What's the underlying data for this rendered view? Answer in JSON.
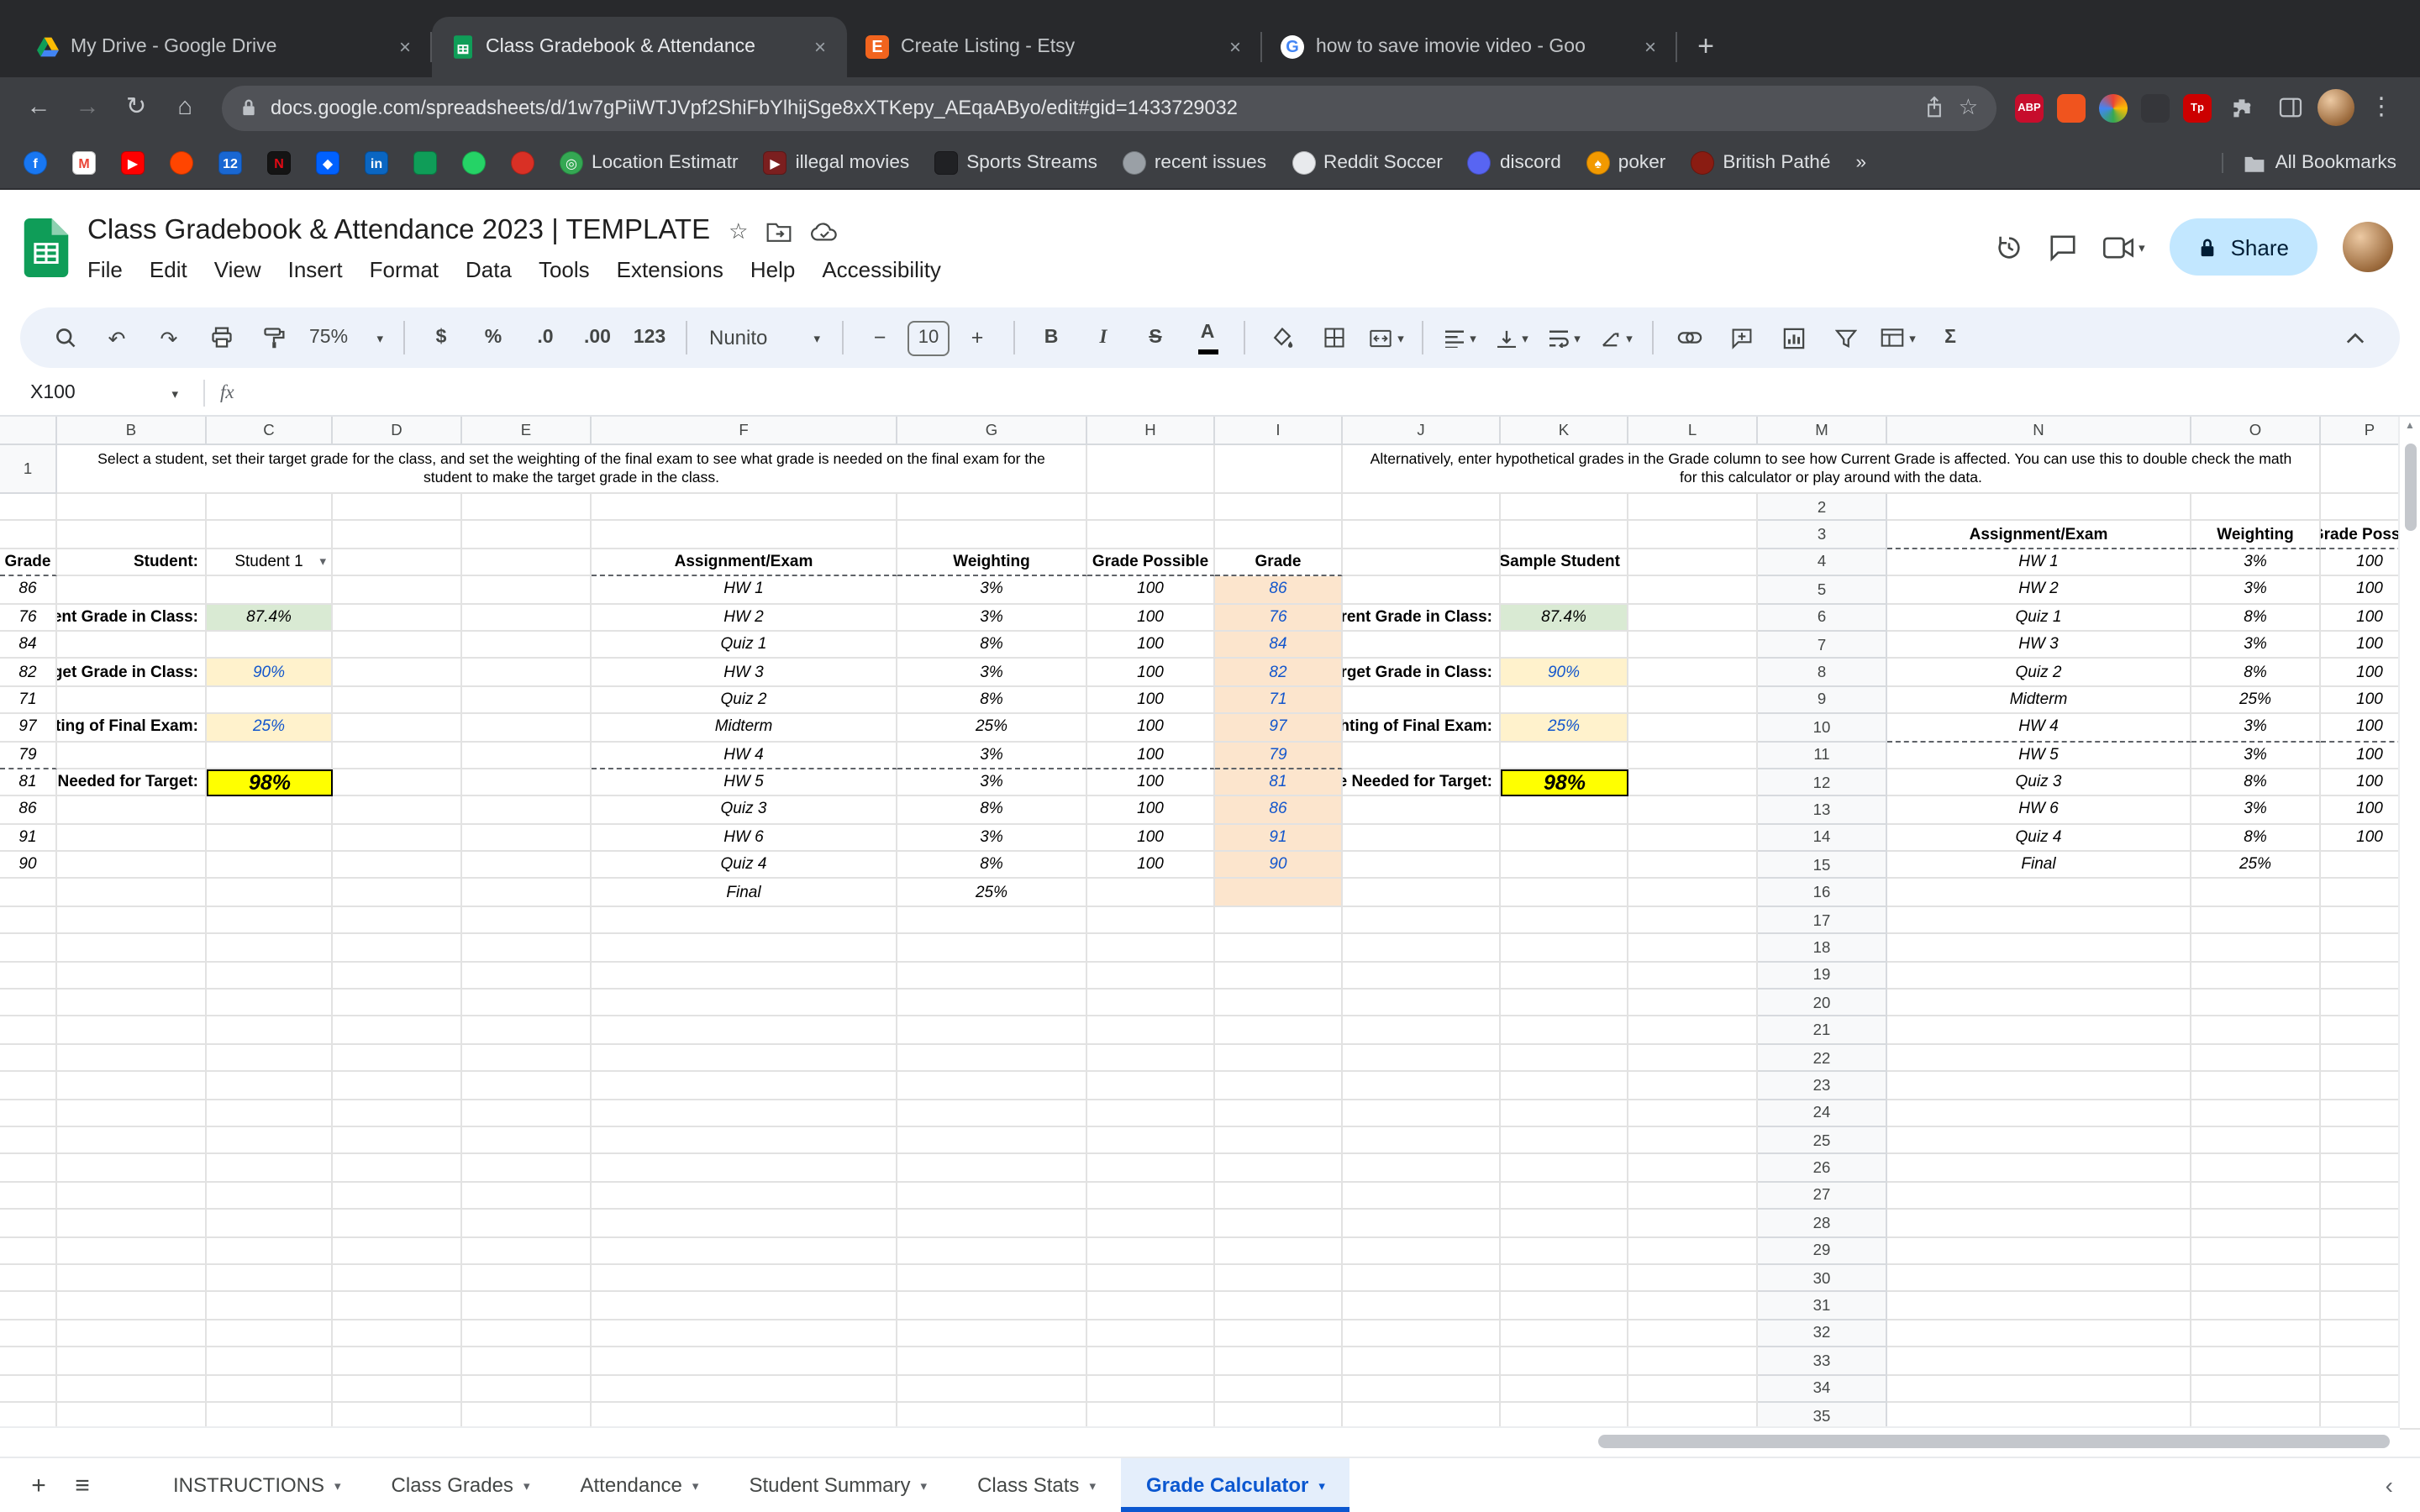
{
  "browser": {
    "tabs": [
      {
        "title": "My Drive - Google Drive",
        "icon": "google-drive"
      },
      {
        "title": "Class Gradebook & Attendance",
        "icon": "google-sheets",
        "active": true
      },
      {
        "title": "Create Listing - Etsy",
        "icon": "etsy"
      },
      {
        "title": "how to save imovie video - Goo",
        "icon": "google"
      }
    ],
    "url": "docs.google.com/spreadsheets/d/1w7gPiiWTJVpf2ShiFbYlhijSge8xXTKepy_AEqaAByo/edit#gid=1433729032",
    "extensions": [
      {
        "name": "adblock-plus",
        "badge": "ABP",
        "color": "#c70d2c"
      },
      {
        "name": "orange-app",
        "badge": "",
        "color": "#f0541e"
      },
      {
        "name": "color-wheel",
        "badge": "",
        "color": "wheel"
      },
      {
        "name": "dark-app",
        "badge": "",
        "color": "#35363a"
      },
      {
        "name": "tp-app",
        "badge": "Tp",
        "color": "#cc0000"
      }
    ],
    "bookmarks": [
      {
        "icon": "facebook",
        "label": "",
        "glyph": "f",
        "color": "#1877f2",
        "text_color": "#ffffff",
        "shape": "circle"
      },
      {
        "icon": "gmail",
        "label": "",
        "glyph": "M",
        "color": "#ffffff",
        "text_color": "#ea4335",
        "shape": "rounded"
      },
      {
        "icon": "youtube",
        "label": "",
        "glyph": "▶",
        "color": "#ff0000",
        "text_color": "#ffffff",
        "shape": "rounded"
      },
      {
        "icon": "reddit",
        "label": "",
        "glyph": "",
        "color": "#ff4500",
        "text_color": "#ffffff",
        "shape": "circle"
      },
      {
        "icon": "calendar-12",
        "label": "",
        "glyph": "12",
        "color": "#1967d2",
        "text_color": "#ffffff",
        "shape": "rounded"
      },
      {
        "icon": "netflix",
        "label": "",
        "glyph": "N",
        "color": "#141414",
        "text_color": "#e50914",
        "shape": "rounded"
      },
      {
        "icon": "dropbox",
        "label": "",
        "glyph": "◆",
        "color": "#0061ff",
        "text_color": "#ffffff",
        "shape": "rounded"
      },
      {
        "icon": "linkedin",
        "label": "",
        "glyph": "in",
        "color": "#0a66c2",
        "text_color": "#ffffff",
        "shape": "rounded"
      },
      {
        "icon": "green-app",
        "label": "",
        "glyph": "",
        "color": "#0f9d58",
        "text_color": "#ffffff",
        "shape": "rounded"
      },
      {
        "icon": "whatsapp",
        "label": "",
        "glyph": "",
        "color": "#25d366",
        "text_color": "#ffffff",
        "shape": "circle"
      },
      {
        "icon": "red-app",
        "label": "",
        "glyph": "",
        "color": "#d93025",
        "text_color": "#ffffff",
        "shape": "circle"
      },
      {
        "icon": "location-pin",
        "label": "Location Estimatr",
        "glyph": "◎",
        "color": "#34a853",
        "text_color": "#ffffff",
        "shape": "circle"
      },
      {
        "icon": "movies",
        "label": "illegal movies",
        "glyph": "▶",
        "color": "#7b1f1f",
        "text_color": "#ffffff",
        "shape": "rounded"
      },
      {
        "icon": "sports",
        "label": "Sports Streams",
        "glyph": "",
        "color": "#202124",
        "text_color": "#ffffff",
        "shape": "rounded"
      },
      {
        "icon": "globe",
        "label": "recent issues",
        "glyph": "",
        "color": "#9aa0a6",
        "text_color": "#ffffff",
        "shape": "circle"
      },
      {
        "icon": "soccer-ball",
        "label": "Reddit Soccer",
        "glyph": "",
        "color": "#e8eaed",
        "text_color": "#202124",
        "shape": "circle"
      },
      {
        "icon": "discord",
        "label": "discord",
        "glyph": "",
        "color": "#5865f2",
        "text_color": "#ffffff",
        "shape": "circle"
      },
      {
        "icon": "poker",
        "label": "poker",
        "glyph": "♠",
        "color": "#f29900",
        "text_color": "#ffffff",
        "shape": "circle"
      },
      {
        "icon": "british-pathe",
        "label": "British Pathé",
        "glyph": "",
        "color": "#8a1c12",
        "text_color": "#ffffff",
        "shape": "circle"
      },
      {
        "icon": "chevron-overflow",
        "label": "»",
        "glyph": "",
        "color": "transparent",
        "text_color": "#dfe1e5",
        "shape": "none"
      }
    ],
    "all_bookmarks_label": "All Bookmarks"
  },
  "sheets": {
    "title": "Class Gradebook & Attendance 2023 | TEMPLATE",
    "menus": [
      "File",
      "Edit",
      "View",
      "Insert",
      "Format",
      "Data",
      "Tools",
      "Extensions",
      "Help",
      "Accessibility"
    ],
    "share_label": "Share",
    "toolbar": {
      "zoom": "75%",
      "font": "Nunito",
      "font_size": "10",
      "currency": "$",
      "percent": "%",
      "dec_decimal": ".0",
      "inc_decimal": ".00",
      "more_formats": "123",
      "bold": "B",
      "italic": "I",
      "strikethrough": "S",
      "text_color": "A",
      "functions": "Σ"
    },
    "formula_bar": {
      "name_box": "X100",
      "fx": "fx"
    }
  },
  "spreadsheet": {
    "column_headers": [
      "B",
      "C",
      "D",
      "E",
      "F",
      "G",
      "H",
      "I",
      "J",
      "K",
      "L",
      "M",
      "N",
      "O",
      "P"
    ],
    "visible_rows": 35,
    "left_note": "Select a student, set their target grade for the class, and set the weighting of the final exam to see what grade is needed on the final exam for the student to make the target grade in the class.",
    "right_note": "Alternatively, enter hypothetical grades in the Grade column to see how Current Grade is affected. You can use this to double check the math for this calculator or play around with the data.",
    "table_headers": [
      "Assignment/Exam",
      "Weighting",
      "Grade Possible",
      "Grade"
    ],
    "student_label": "Student:",
    "student_value": "Student 1",
    "sample_student_label": "Sample Student",
    "assignments": [
      {
        "name": "HW 1",
        "weighting": "3%",
        "grade_possible": "100",
        "grade": "86"
      },
      {
        "name": "HW 2",
        "weighting": "3%",
        "grade_possible": "100",
        "grade": "76"
      },
      {
        "name": "Quiz 1",
        "weighting": "8%",
        "grade_possible": "100",
        "grade": "84"
      },
      {
        "name": "HW 3",
        "weighting": "3%",
        "grade_possible": "100",
        "grade": "82"
      },
      {
        "name": "Quiz 2",
        "weighting": "8%",
        "grade_possible": "100",
        "grade": "71"
      },
      {
        "name": "Midterm",
        "weighting": "25%",
        "grade_possible": "100",
        "grade": "97"
      },
      {
        "name": "HW 4",
        "weighting": "3%",
        "grade_possible": "100",
        "grade": "79"
      },
      {
        "name": "HW 5",
        "weighting": "3%",
        "grade_possible": "100",
        "grade": "81"
      },
      {
        "name": "Quiz 3",
        "weighting": "8%",
        "grade_possible": "100",
        "grade": "86"
      },
      {
        "name": "HW 6",
        "weighting": "3%",
        "grade_possible": "100",
        "grade": "91"
      },
      {
        "name": "Quiz 4",
        "weighting": "8%",
        "grade_possible": "100",
        "grade": "90"
      },
      {
        "name": "Final",
        "weighting": "25%",
        "grade_possible": "",
        "grade": ""
      }
    ],
    "summary": [
      {
        "label": "Current Grade in Class:",
        "value": "87.4%",
        "row": 5,
        "style": "green"
      },
      {
        "label": "Target Grade in Class:",
        "value": "90%",
        "row": 7,
        "style": "cream-blue"
      },
      {
        "label": "Weighting of Final Exam:",
        "value": "25%",
        "row": 9,
        "style": "cream-blue"
      },
      {
        "label": "Final Exam Grade Needed for Target:",
        "value": "98%",
        "row": 11,
        "style": "yellow-big"
      }
    ],
    "dashed_separator_rows": [
      3,
      10
    ],
    "colors": {
      "green": "#d9ead3",
      "cream": "#fff2cc",
      "orange": "#fce5cd",
      "yellow": "#ffff00",
      "blue_text": "#1155cc"
    }
  },
  "ui_colors": {
    "accent": "#0b57d0",
    "share_button_bg": "#c2e7ff",
    "share_button_text": "#001d35",
    "active_sheet_tab_bg": "#e4eefb"
  },
  "sheet_tabs": {
    "tabs": [
      "INSTRUCTIONS",
      "Class Grades",
      "Attendance",
      "Student Summary",
      "Class Stats",
      "Grade Calculator"
    ],
    "active": "Grade Calculator",
    "active_index": 5
  }
}
